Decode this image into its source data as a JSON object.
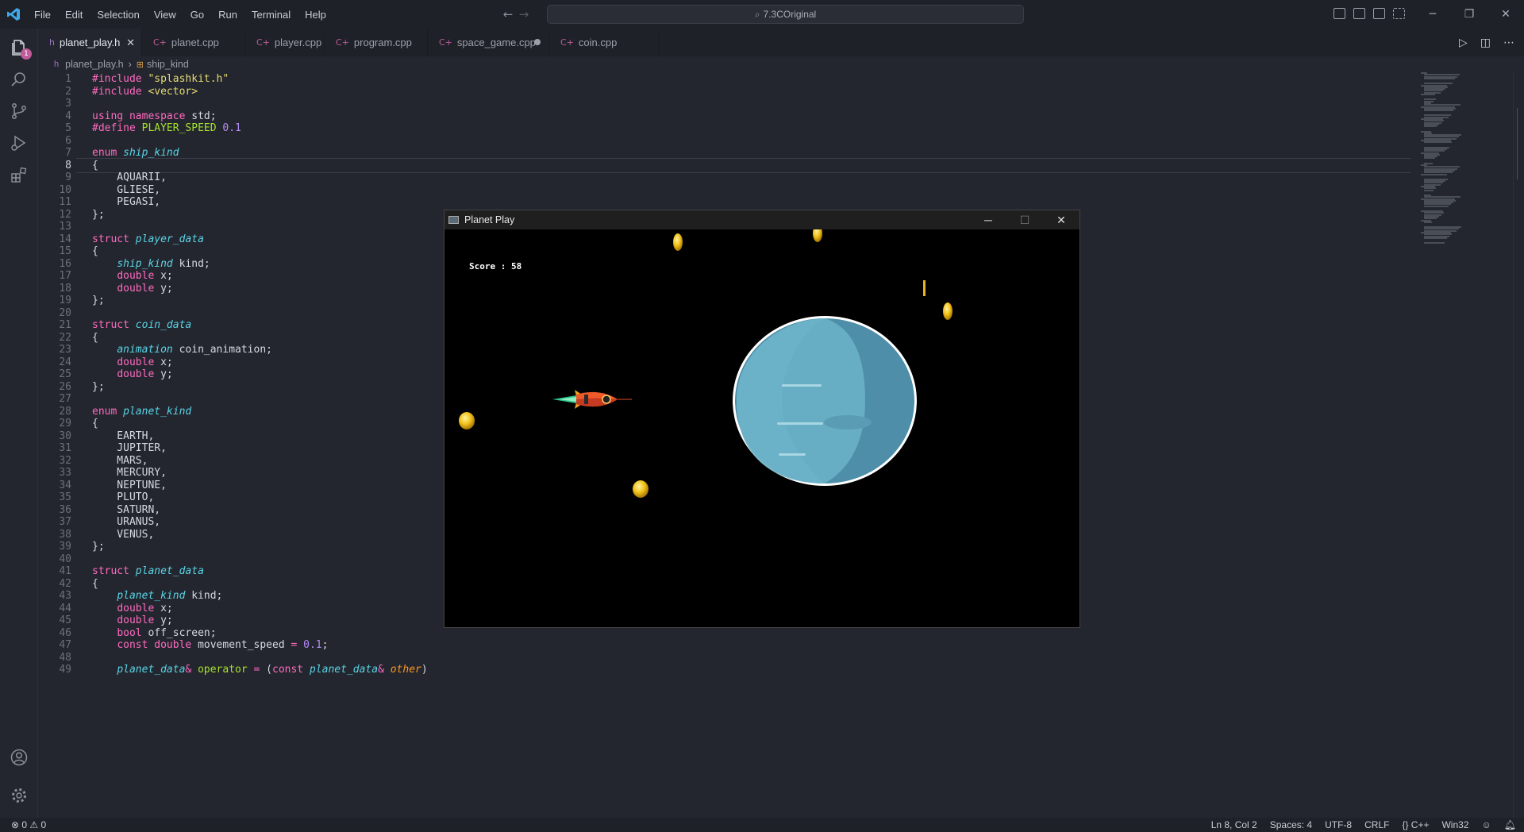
{
  "titlebar": {
    "menu": [
      "File",
      "Edit",
      "Selection",
      "View",
      "Go",
      "Run",
      "Terminal",
      "Help"
    ],
    "command_center": "7.3COriginal"
  },
  "activitybar": {
    "icons": [
      "explorer-icon",
      "search-icon",
      "source-control-icon",
      "run-debug-icon",
      "extensions-icon",
      "account-icon",
      "settings-gear-icon"
    ],
    "explorer_badge": "1"
  },
  "tabs": [
    {
      "label": "planet_play.h",
      "type": "h",
      "active": true,
      "close": "✕"
    },
    {
      "label": "planet.cpp",
      "type": "cpp"
    },
    {
      "label": "player.cpp",
      "type": "cpp"
    },
    {
      "label": "program.cpp",
      "type": "cpp"
    },
    {
      "label": "space_game.cpp",
      "type": "cpp",
      "modified": true
    },
    {
      "label": "coin.cpp",
      "type": "cpp"
    }
  ],
  "breadcrumb": {
    "file": "planet_play.h",
    "symbol": "ship_kind"
  },
  "editor": {
    "current_line": 8,
    "lines": [
      {
        "n": "1",
        "html": "<span class='kw'>#include</span> <span class='str'>\"splashkit.h\"</span>"
      },
      {
        "n": "2",
        "html": "<span class='kw'>#include</span> <span class='str'>&lt;vector&gt;</span>"
      },
      {
        "n": "3",
        "html": ""
      },
      {
        "n": "4",
        "html": "<span class='kw'>using</span> <span class='kw'>namespace</span> std;"
      },
      {
        "n": "5",
        "html": "<span class='kw'>#define</span> <span class='mac'>PLAYER_SPEED</span> <span class='num'>0.1</span>"
      },
      {
        "n": "6",
        "html": ""
      },
      {
        "n": "7",
        "html": "<span class='kw'>enum</span> <span class='ty'>ship_kind</span>"
      },
      {
        "n": "8",
        "html": "{"
      },
      {
        "n": "9",
        "html": "    AQUARII,"
      },
      {
        "n": "10",
        "html": "    GLIESE,"
      },
      {
        "n": "11",
        "html": "    PEGASI,"
      },
      {
        "n": "12",
        "html": "};"
      },
      {
        "n": "13",
        "html": ""
      },
      {
        "n": "14",
        "html": "<span class='kw'>struct</span> <span class='ty'>player_data</span>"
      },
      {
        "n": "15",
        "html": "{"
      },
      {
        "n": "16",
        "html": "    <span class='ty'>ship_kind</span> kind;"
      },
      {
        "n": "17",
        "html": "    <span class='kw'>double</span> x;"
      },
      {
        "n": "18",
        "html": "    <span class='kw'>double</span> y;"
      },
      {
        "n": "19",
        "html": "};"
      },
      {
        "n": "20",
        "html": ""
      },
      {
        "n": "21",
        "html": "<span class='kw'>struct</span> <span class='ty'>coin_data</span>"
      },
      {
        "n": "22",
        "html": "{"
      },
      {
        "n": "23",
        "html": "    <span class='ty'>animation</span> coin_animation;"
      },
      {
        "n": "24",
        "html": "    <span class='kw'>double</span> x;"
      },
      {
        "n": "25",
        "html": "    <span class='kw'>double</span> y;"
      },
      {
        "n": "26",
        "html": "};"
      },
      {
        "n": "27",
        "html": ""
      },
      {
        "n": "28",
        "html": "<span class='kw'>enum</span> <span class='ty'>planet_kind</span>"
      },
      {
        "n": "29",
        "html": "{"
      },
      {
        "n": "30",
        "html": "    EARTH,"
      },
      {
        "n": "31",
        "html": "    JUPITER,"
      },
      {
        "n": "32",
        "html": "    MARS,"
      },
      {
        "n": "33",
        "html": "    MERCURY,"
      },
      {
        "n": "34",
        "html": "    NEPTUNE,"
      },
      {
        "n": "35",
        "html": "    PLUTO,"
      },
      {
        "n": "36",
        "html": "    SATURN,"
      },
      {
        "n": "37",
        "html": "    URANUS,"
      },
      {
        "n": "38",
        "html": "    VENUS,"
      },
      {
        "n": "39",
        "html": "};"
      },
      {
        "n": "40",
        "html": ""
      },
      {
        "n": "41",
        "html": "<span class='kw'>struct</span> <span class='ty'>planet_data</span>"
      },
      {
        "n": "42",
        "html": "{"
      },
      {
        "n": "43",
        "html": "    <span class='ty'>planet_kind</span> kind;"
      },
      {
        "n": "44",
        "html": "    <span class='kw'>double</span> x;"
      },
      {
        "n": "45",
        "html": "    <span class='kw'>double</span> y;"
      },
      {
        "n": "46",
        "html": "    <span class='kw'>bool</span> off_screen;"
      },
      {
        "n": "47",
        "html": "    <span class='kw'>const</span> <span class='kw'>double</span> movement_speed <span class='op'>=</span> <span class='num'>0.1</span>;"
      },
      {
        "n": "48",
        "html": ""
      },
      {
        "n": "49",
        "html": "    <span class='ty'>planet_data</span><span class='op'>&amp;</span> <span class='mac'>operator</span> <span class='op'>=</span> (<span class='kw'>const</span> <span class='ty'>planet_data</span><span class='op'>&amp;</span> <span class='par'>other</span>)"
      }
    ]
  },
  "game_window": {
    "title": "Planet Play",
    "score_label": "Score : 58",
    "controls": [
      "─",
      "☐",
      "✕"
    ]
  },
  "statusbar": {
    "problems": "⊗ 0 ⚠ 0",
    "position": "Ln 8, Col 2",
    "spaces": "Spaces: 4",
    "encoding": "UTF-8",
    "eol": "CRLF",
    "language": "{} C++",
    "platform": "Win32"
  },
  "colors": {
    "accent": "#5ad4e6",
    "keyword": "#ff6ac1",
    "string": "#e6db74",
    "number": "#b58cf7"
  }
}
